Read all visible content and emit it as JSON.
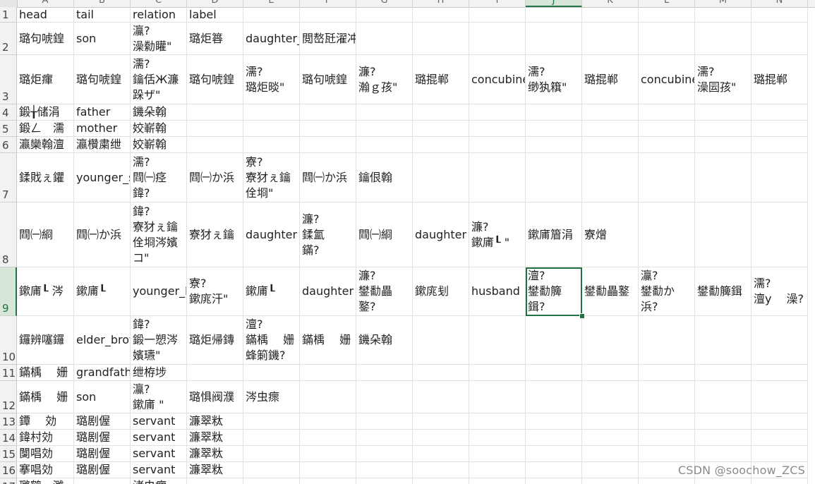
{
  "columns": [
    "A",
    "B",
    "C",
    "D",
    "E",
    "F",
    "G",
    "H",
    "I",
    "J",
    "K",
    "L",
    "M",
    "N"
  ],
  "selected_column": "J",
  "selected_row": "9",
  "rows": [
    {
      "n": "1",
      "cells": [
        "head",
        "tail",
        "relation",
        "label",
        "",
        "",
        "",
        "",
        "",
        "",
        "",
        "",
        "",
        ""
      ]
    },
    {
      "n": "2",
      "cells": [
        "璐句唬鍠",
        "son",
        "灜?\n澡勬矔\"",
        "璐炬簭",
        "daughter_",
        "閲嶅瓩濯冲",
        "",
        "",
        "",
        "",
        "",
        "",
        "",
        ""
      ]
    },
    {
      "n": "3",
      "cells": [
        "璐炬瘒",
        "璐句唬鍠",
        "濡?\n鑰佸Ж濂\n跺ザ\"",
        "璐句唬鍠",
        "濡?\n璐炬晱\"",
        "璐句唬鍠",
        "濂?\n瀚ｇ孩\"",
        "璐掍郸",
        "concubine",
        "濡?\n缈犱簯\"",
        "璐掍郸",
        "concubine",
        "濡?\n澡囩孩\"",
        "璐掍郸"
      ]
    },
    {
      "n": "4",
      "cells": [
        "鍛╁储涓",
        "father",
        "鐖朵翰",
        "",
        "",
        "",
        "",
        "",
        "",
        "",
        "",
        "",
        "",
        ""
      ]
    },
    {
      "n": "5",
      "cells": [
        "鍛ㄥ　濡",
        "mother",
        "姣嶄翰",
        "",
        "",
        "",
        "",
        "",
        "",
        "",
        "",
        "",
        "",
        ""
      ]
    },
    {
      "n": "6",
      "cells": [
        "瀛欒翰澶",
        "瀛欑粛绁",
        "姣嶄翰",
        "",
        "",
        "",
        "",
        "",
        "",
        "",
        "",
        "",
        "",
        ""
      ]
    },
    {
      "n": "7",
      "cells": [
        "鍒戝ぇ鑺",
        "younger_s",
        "濡?\n閰㈠痉\n鍏?",
        "閰㈠か浜",
        "寮?\n寮犲ぇ鑰\n佺埛\"",
        "閰㈠か浜",
        "鑰佷翰",
        "",
        "",
        "",
        "",
        "",
        "",
        ""
      ]
    },
    {
      "n": "8",
      "cells": [
        "閰㈠綗",
        "閰㈠か浜",
        "鍏?\n寮犲ぇ鑰\n佺埛涔嬪\nコ\"",
        "寮犲ぇ鑰",
        "daughter",
        "濂?\n鍒氳\n鏋?",
        "閰㈠綗",
        "daughter",
        "濂?\n鏉庯┖ \"",
        "鏉庯篃涓",
        "寮熷",
        "",
        "",
        ""
      ]
    },
    {
      "n": "9",
      "cells": [
        "鏉庯┖ 涔",
        "鏉庯┖",
        "younger_b",
        "寮?\n鏉庣汗\"",
        "鏉庯┖",
        "daughter",
        "濂?\n鐢勫畾\n鐜?",
        "鏉庣刬",
        "husband",
        "澶?\n鐢勫簲\n鍓?",
        "鐢勫畾鐜",
        "灜?\n鐢勫か\n浜?",
        "鐢勫簲鍓",
        "濡?\n澶у　 澡?"
      ]
    },
    {
      "n": "10",
      "cells": [
        "鑼辨噻鑼",
        "elder_brot",
        "鍏?\n鍛一愬涔\n嬪瓙\"",
        "璐炬帰鏄",
        "澶?\n鏋楀　 姗\n蜂箣鐖?",
        "鏋楀　 姗",
        "鐖朵翰",
        "",
        "",
        "",
        "",
        "",
        "",
        ""
      ]
    },
    {
      "n": "11",
      "cells": [
        "鏋楀　 姗",
        "grandfath",
        "绁栫埗",
        "",
        "",
        "",
        "",
        "",
        "",
        "",
        "",
        "",
        "",
        ""
      ]
    },
    {
      "n": "12",
      "cells": [
        "鏋楀　 姗",
        "son",
        "灜?\n鏉庯 \"",
        "璐惧阀濮",
        "涔虫瘝",
        "",
        "",
        "",
        "",
        "",
        "",
        "",
        "",
        ""
      ]
    },
    {
      "n": "13",
      "cells": [
        "鐔　 効",
        "璐剧偓",
        "servant",
        "濂翠粏",
        "",
        "",
        "",
        "",
        "",
        "",
        "",
        "",
        "",
        ""
      ]
    },
    {
      "n": "14",
      "cells": [
        "鍏村効",
        "璐剧偓",
        "servant",
        "濂翠粏",
        "",
        "",
        "",
        "",
        "",
        "",
        "",
        "",
        "",
        ""
      ]
    },
    {
      "n": "15",
      "cells": [
        "闅唱効",
        "璐剧偓",
        "servant",
        "濂翠粏",
        "",
        "",
        "",
        "",
        "",
        "",
        "",
        "",
        "",
        ""
      ]
    },
    {
      "n": "16",
      "cells": [
        "搴唱効",
        "璐剧偓",
        "servant",
        "濂翠粏",
        "",
        "",
        "",
        "",
        "",
        "",
        "",
        "",
        "",
        ""
      ]
    },
    {
      "n": "17",
      "cells": [
        "璐鹤　濉",
        "",
        "渚虫瘒",
        "",
        "",
        "",
        "",
        "",
        "",
        "",
        "",
        "",
        "",
        ""
      ]
    }
  ],
  "watermark": "CSDN @soochow_ZCS",
  "colors": {
    "accent": "#217346",
    "grid": "#e1e1e1",
    "header_bg": "#f2f2f2"
  }
}
